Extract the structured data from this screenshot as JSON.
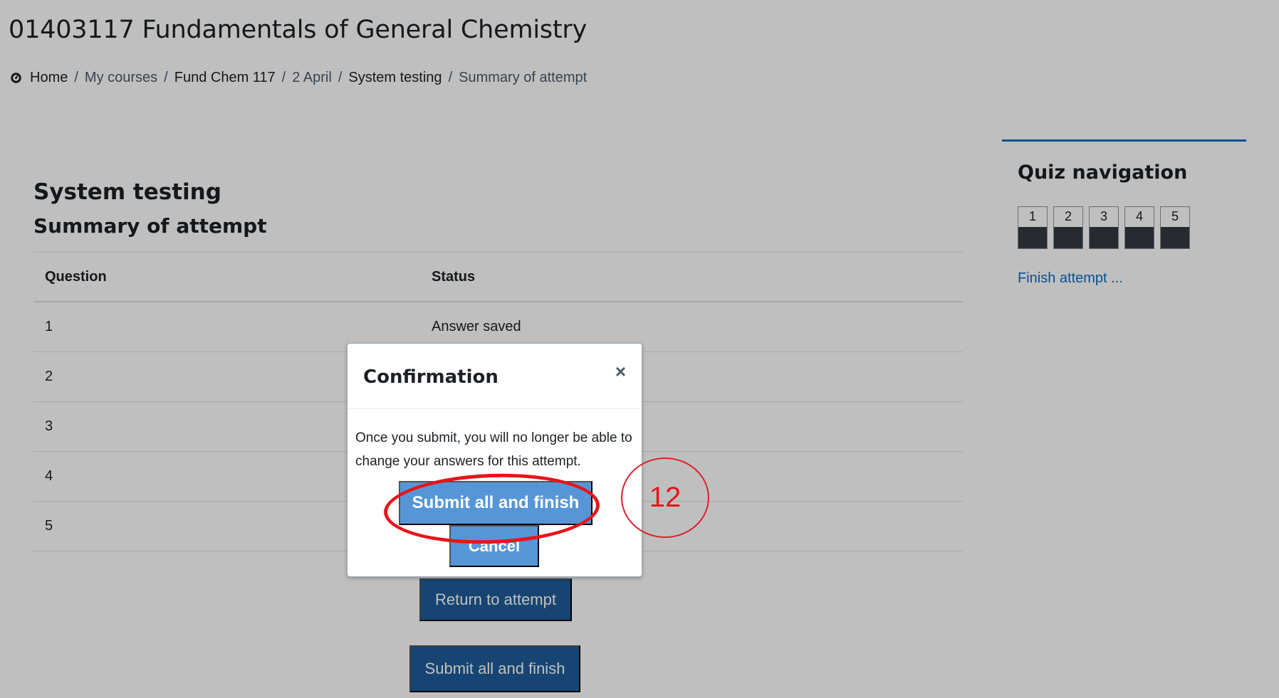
{
  "page": {
    "course_title": "01403117 Fundamentals of General Chemistry"
  },
  "breadcrumb": [
    {
      "label": "Home",
      "muted": false
    },
    {
      "label": "My courses",
      "muted": true
    },
    {
      "label": "Fund Chem 117",
      "muted": false
    },
    {
      "label": "2 April",
      "muted": true
    },
    {
      "label": "System testing",
      "muted": false
    },
    {
      "label": "Summary of attempt",
      "muted": true
    }
  ],
  "breadcrumb_separator": "/",
  "main": {
    "heading": "System testing",
    "subheading": "Summary of attempt",
    "table": {
      "headers": [
        "Question",
        "Status"
      ],
      "rows": [
        {
          "question": "1",
          "status": "Answer saved"
        },
        {
          "question": "2",
          "status": ""
        },
        {
          "question": "3",
          "status": ""
        },
        {
          "question": "4",
          "status": ""
        },
        {
          "question": "5",
          "status": ""
        }
      ]
    },
    "return_button": "Return to attempt",
    "submit_button": "Submit all and finish"
  },
  "quiz_nav": {
    "title": "Quiz navigation",
    "buttons": [
      "1",
      "2",
      "3",
      "4",
      "5"
    ],
    "finish_link": "Finish attempt ..."
  },
  "modal": {
    "title": "Confirmation",
    "close_glyph": "×",
    "body": "Once you submit, you will no longer be able to change your answers for this attempt.",
    "submit_button": "Submit all and finish",
    "cancel_button": "Cancel"
  },
  "annotation": {
    "step_number": "12",
    "color": "#e8141a"
  },
  "colors": {
    "primary_button": "#1f5d9a",
    "modal_button": "#5796d6",
    "link": "#0f6cbf",
    "nav_border_top": "#0f6cbf"
  },
  "icons": {
    "home": "dashboard-gauge-icon",
    "close": "close-icon"
  }
}
